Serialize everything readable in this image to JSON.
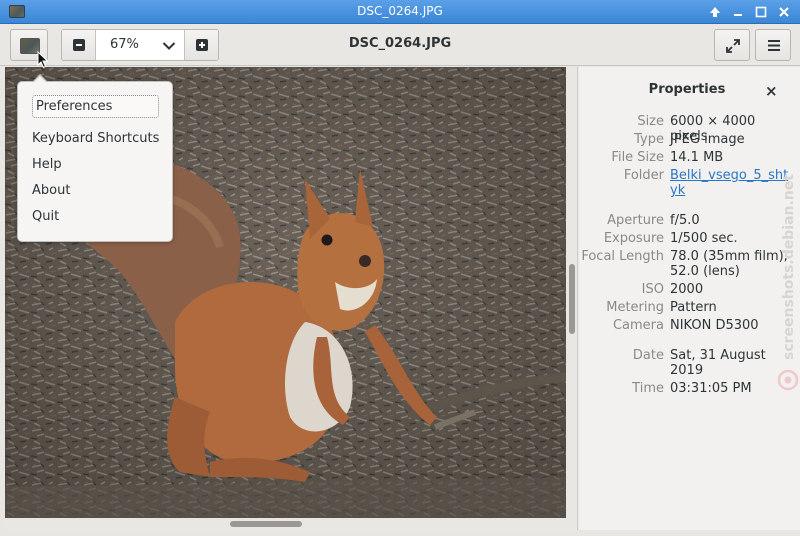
{
  "window": {
    "title": "DSC_0264.JPG"
  },
  "toolbar": {
    "zoom_value": "67%",
    "title": "DSC_0264.JPG"
  },
  "menu": {
    "items": [
      {
        "label": "Preferences"
      },
      {
        "label": "Keyboard Shortcuts"
      },
      {
        "label": "Help"
      },
      {
        "label": "About"
      },
      {
        "label": "Quit"
      }
    ]
  },
  "properties": {
    "title": "Properties",
    "close_label": "×",
    "rows": [
      {
        "key": "Size",
        "value": "6000 × 4000 pixels"
      },
      {
        "key": "Type",
        "value": "JPEG image"
      },
      {
        "key": "File Size",
        "value": "14.1 MB"
      },
      {
        "key": "Folder",
        "value": "Belki_vsego_5_shtyk"
      },
      {
        "key": "Aperture",
        "value": "f/5.0"
      },
      {
        "key": "Exposure",
        "value": "1/500 sec."
      },
      {
        "key": "Focal Length",
        "value": "78.0 (35mm film), 52.0 (lens)"
      },
      {
        "key": "ISO",
        "value": "2000"
      },
      {
        "key": "Metering",
        "value": "Pattern"
      },
      {
        "key": "Camera",
        "value": "NIKON D5300"
      },
      {
        "key": "Date",
        "value": "Sat, 31 August 2019"
      },
      {
        "key": "Time",
        "value": "03:31:05 PM"
      }
    ]
  },
  "watermark": {
    "text": "screenshots.debian.net"
  },
  "icons": {
    "app": "app-thumbnail-icon",
    "zoom_out": "zoom-out-icon",
    "zoom_in": "zoom-in-icon",
    "dropdown": "chevron-down-icon",
    "fullscreen": "fullscreen-icon",
    "menu": "hamburger-menu-icon",
    "close": "close-icon"
  }
}
